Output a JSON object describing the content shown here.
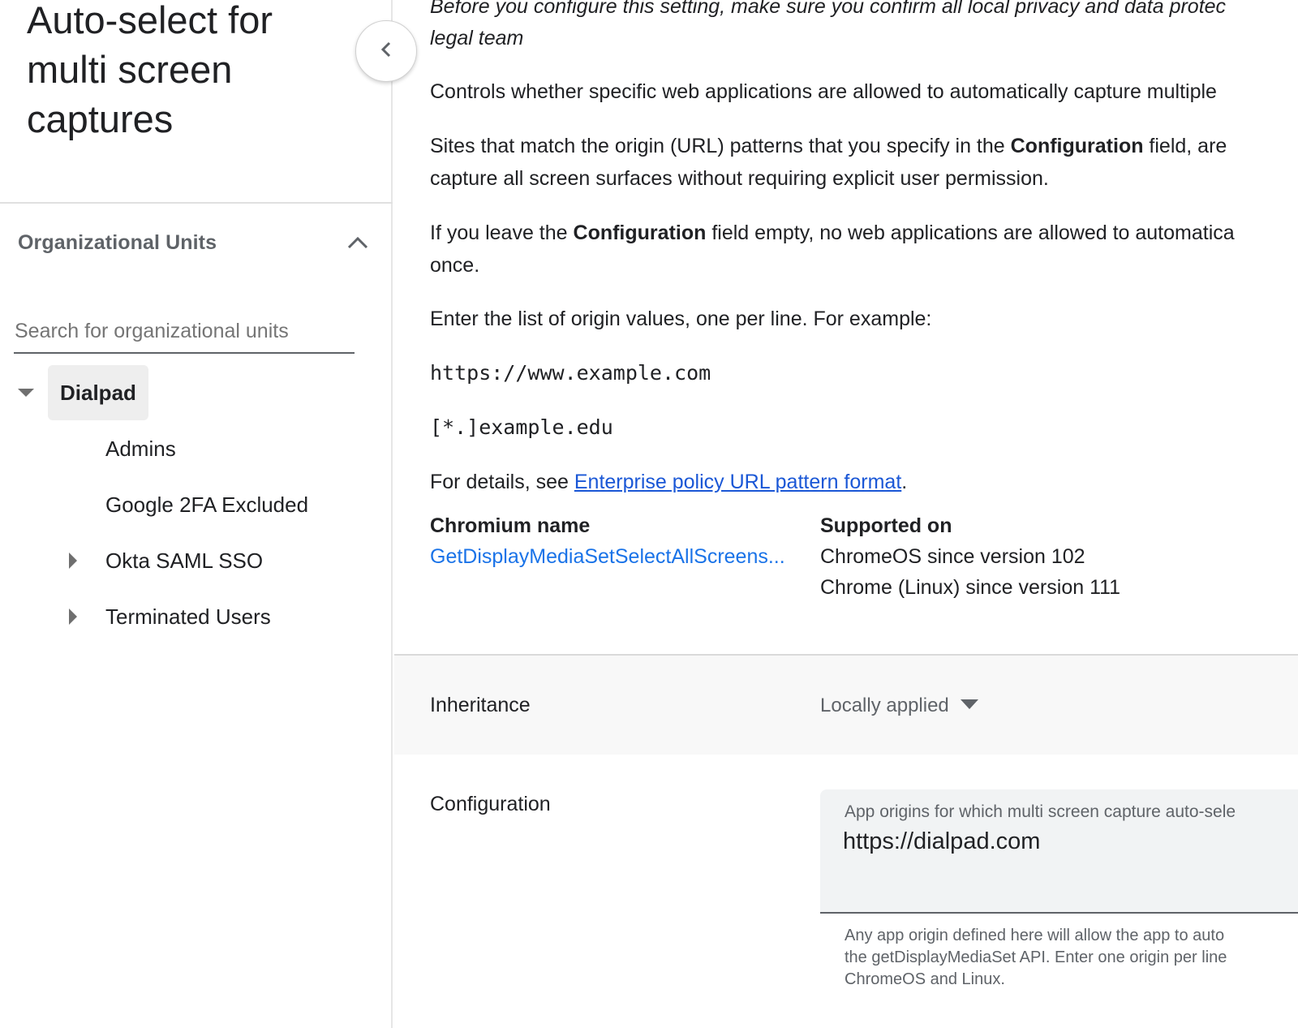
{
  "sidebar": {
    "setting_title": "Auto-select for multi screen captures",
    "collapse_button_icon": "chevron-left-icon",
    "org_units": {
      "header_label": "Organizational Units",
      "header_icon": "chevron-up-icon",
      "search_placeholder": "Search for organizational units",
      "search_value": "",
      "tree": [
        {
          "label": "Dialpad",
          "level": 0,
          "expanded": true,
          "has_children": true,
          "selected": true
        },
        {
          "label": "Admins",
          "level": 1,
          "expanded": false,
          "has_children": false,
          "selected": false
        },
        {
          "label": "Google 2FA Excluded",
          "level": 1,
          "expanded": false,
          "has_children": false,
          "selected": false
        },
        {
          "label": "Okta SAML SSO",
          "level": 1,
          "expanded": false,
          "has_children": true,
          "selected": false
        },
        {
          "label": "Terminated Users",
          "level": 1,
          "expanded": false,
          "has_children": true,
          "selected": false
        }
      ]
    }
  },
  "main": {
    "warning_line1": "Before you configure this setting, make sure you confirm all local privacy and data protec",
    "warning_line2": "legal team",
    "para_controls": "Controls whether specific web applications are allowed to automatically capture multiple",
    "para_sites_pre": "Sites that match the origin (URL) patterns that you specify in the ",
    "para_sites_bold": "Configuration",
    "para_sites_post": " field, are",
    "para_sites_line2": "capture all screen surfaces without requiring explicit user permission.",
    "para_empty_pre": "If you leave the ",
    "para_empty_bold": "Configuration",
    "para_empty_post": " field empty, no web applications are allowed to automatica",
    "para_empty_line2": "once.",
    "para_enter": "Enter the list of origin values, one per line. For example:",
    "example_1": "https://www.example.com",
    "example_2": "[*.]example.edu",
    "details_pre": "For details, see ",
    "details_link": "Enterprise policy URL pattern format",
    "details_post": ".",
    "chromium_name_header": "Chromium name",
    "chromium_name_value": "GetDisplayMediaSetSelectAllScreens...",
    "supported_on_header": "Supported on",
    "supported_on": [
      "ChromeOS since version 102",
      "Chrome (Linux) since version 111"
    ],
    "inheritance": {
      "label": "Inheritance",
      "selected": "Locally applied",
      "icon": "dropdown-arrow-icon"
    },
    "configuration": {
      "label": "Configuration",
      "field_label": "App origins for which multi screen capture auto-sele",
      "field_value": "https://dialpad.com",
      "help_line1": "Any app origin defined here will allow the app to auto",
      "help_line2": "the getDisplayMediaSet API. Enter one origin per line",
      "help_line3": "ChromeOS and Linux."
    }
  },
  "colors": {
    "link": "#1a57d6",
    "chromium_link": "#1a73e8",
    "selected_bg": "#eeeeee",
    "band_bg": "#f8f8f8",
    "field_bg": "#f1f3f4",
    "muted_text": "#5f6368"
  }
}
